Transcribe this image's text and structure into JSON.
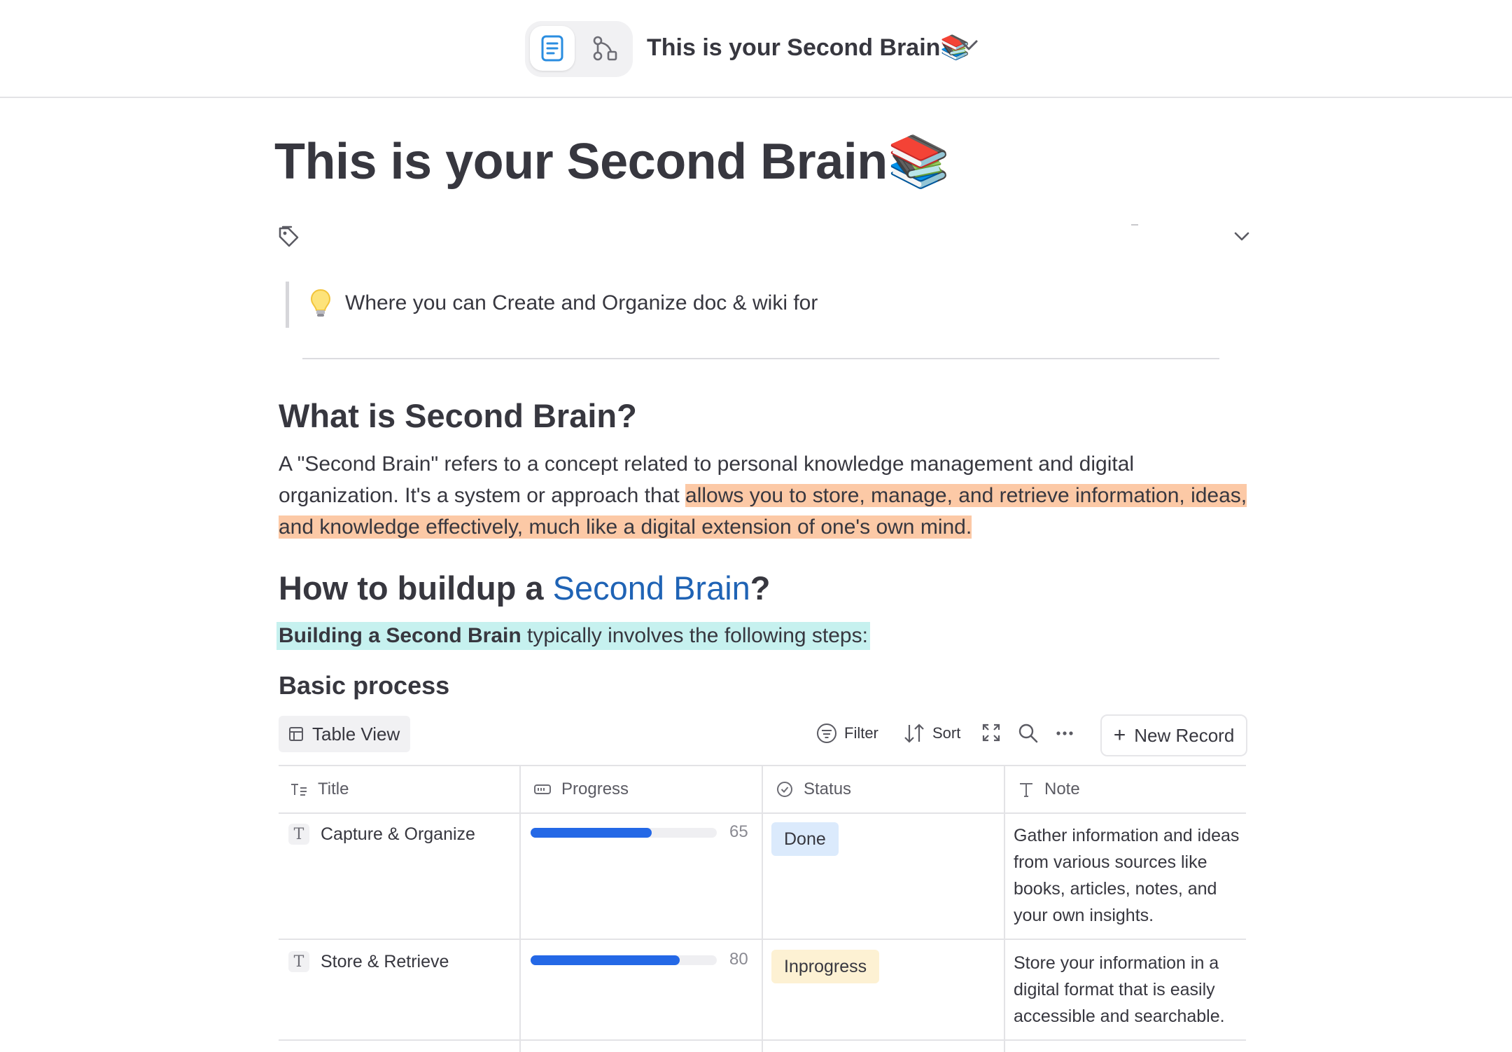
{
  "header": {
    "title": "This is your Second Brain📚"
  },
  "page": {
    "title": "This is your Second Brain📚",
    "callout_text": "Where you can Create and Organize doc & wiki  for"
  },
  "section1": {
    "heading": "What is Second Brain?",
    "paragraph_plain": "A \"Second Brain\" refers to a concept related to personal knowledge management and digital organization. It's a system or approach that ",
    "paragraph_highlight": "allows you to store, manage, and retrieve information, ideas, and knowledge effectively, much like a digital extension of one's own mind."
  },
  "section2": {
    "heading_prefix": "How to buildup a ",
    "heading_link": "Second Brain",
    "heading_suffix": "?",
    "intro_bold": "Building a Second Brain",
    "intro_rest": " typically involves the following steps:"
  },
  "database": {
    "title": "Basic process",
    "view_label": "Table View",
    "filter_label": "Filter",
    "sort_label": "Sort",
    "new_record_label": "New Record",
    "columns": [
      "Title",
      "Progress",
      "Status",
      "Note"
    ],
    "rows": [
      {
        "title": "Capture & Organize",
        "progress": 65,
        "status": "Done",
        "note": "Gather information and ideas from various sources like books, articles, notes, and your own insights."
      },
      {
        "title": "Store & Retrieve",
        "progress": 80,
        "status": "Inprogress",
        "note": "Store your information in a digital format that is easily accessible and searchable."
      }
    ]
  },
  "colors": {
    "accent": "#2468e6",
    "link": "#1f63b5",
    "highlight_orange": "#fcc9a6",
    "highlight_teal": "#c6f1ef",
    "status_done": "#dbeafc",
    "status_inprogress": "#fdf1d3"
  },
  "icons": [
    "doc-icon",
    "graph-icon",
    "chevron-down-icon",
    "tag-icon",
    "lightbulb-icon",
    "table-icon",
    "filter-icon",
    "sort-icon",
    "expand-icon",
    "search-icon",
    "more-icon",
    "plus-icon",
    "text-type-icon",
    "progress-type-icon",
    "status-type-icon"
  ]
}
